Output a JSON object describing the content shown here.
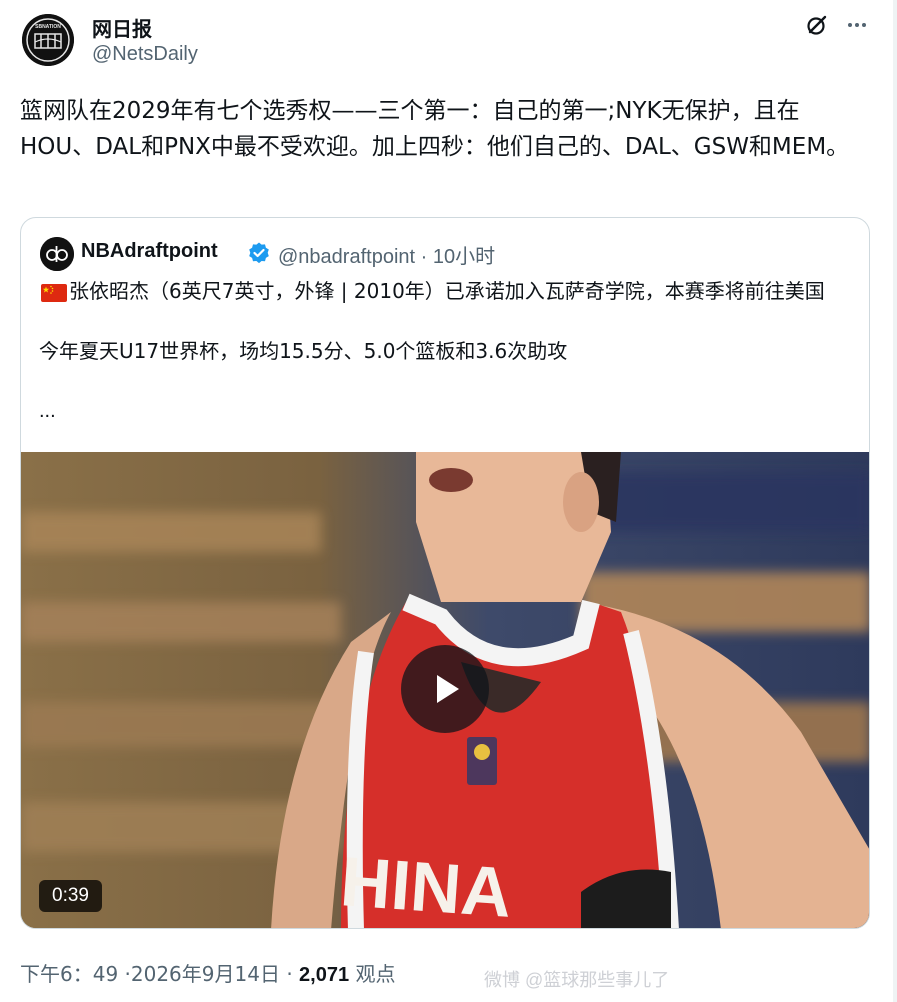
{
  "tweet": {
    "author_name": "网日报",
    "author_handle": "@NetsDaily",
    "text": "篮网队在2029年有七个选秀权——三个第一：自己的第一;NYK无保护，且在HOU、DAL和PNX中最不受欢迎。加上四秒：他们自己的、DAL、GSW和MEM。",
    "avatar_logo_text": "SBNATION"
  },
  "quote": {
    "author_name": "NBAdraftpoint",
    "author_handle": "@nbadraftpoint · 10小时",
    "flag": "cn-flag",
    "text_line1": "张依昭杰（6英尺7英寸，外锋 | 2010年）已承诺加入瓦萨奇学院，本赛季将前往美国",
    "text_line2": "今年夏天U17世界杯，场均15.5分、5.0个篮板和3.6次助攻",
    "ellipsis": "...",
    "video": {
      "duration": "0:39",
      "jersey_text": "HINA"
    }
  },
  "footer": {
    "timestamp": "下午6：49 ·2026年9月14日 · ",
    "views_count": "2,071",
    "views_label": " 观点",
    "watermark": "微博 @篮球那些事儿了"
  },
  "icons": {
    "grok": "grok-icon",
    "more": "more-icon",
    "verified": "verified-badge-icon",
    "play": "play-icon"
  },
  "colors": {
    "verified_blue": "#1d9bf0",
    "secondary_text": "#536471",
    "border": "#cfd9de"
  }
}
